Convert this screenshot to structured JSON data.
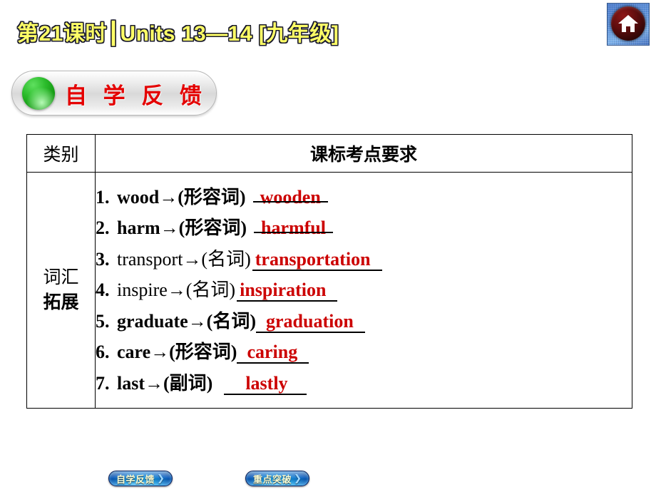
{
  "header": {
    "title": "第21课时┃Units 13—14 [九年级]",
    "home_icon": "home-icon"
  },
  "banner": {
    "label": "自 学 反 馈",
    "bullet_color": "#2bbb2b",
    "text_color": "#e40000"
  },
  "table": {
    "headers": {
      "category": "类别",
      "requirement": "课标考点要求"
    },
    "category_cell": {
      "line1": "词汇",
      "line2": "拓展"
    },
    "items": [
      {
        "num": "1.",
        "question": "wood→(形容词)",
        "answer": "wooden"
      },
      {
        "num": "2.",
        "question": "harm→(形容词)",
        "answer": "harmful"
      },
      {
        "num": "3.",
        "question": "transport→(名词)",
        "answer": "transportation"
      },
      {
        "num": "4.",
        "question": "inspire→(名词)",
        "answer": "inspiration"
      },
      {
        "num": "5.",
        "question": "graduate→(名词)",
        "answer": "graduation"
      },
      {
        "num": "6.",
        "question": "care→(形容词)",
        "answer": "caring"
      },
      {
        "num": "7.",
        "question": "last→(副词)",
        "answer": "lastly"
      }
    ],
    "answer_color": "#cc0000"
  },
  "footer": {
    "nav": [
      {
        "label": "自学反馈",
        "chevron": "❯"
      },
      {
        "label": "重点突破",
        "chevron": "❯"
      }
    ]
  }
}
